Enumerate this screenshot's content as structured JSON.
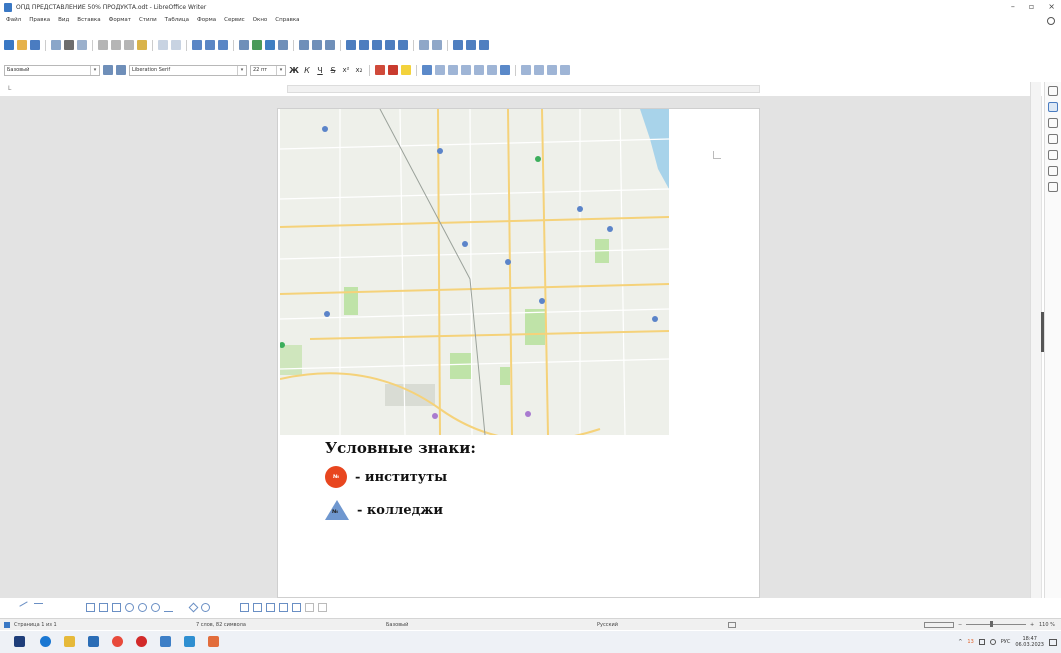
{
  "window": {
    "title": "ОПД ПРЕДСТАВЛЕНИЕ 50% ПРОДУКТА.odt - LibreOffice Writer",
    "controls": [
      "–",
      "▫",
      "×"
    ]
  },
  "menu": [
    "Файл",
    "Правка",
    "Вид",
    "Вставка",
    "Формат",
    "Стили",
    "Таблица",
    "Форма",
    "Сервис",
    "Окно",
    "Справка"
  ],
  "format_toolbar": {
    "paragraph_style": "Базовый",
    "font_name": "Liberation Serif",
    "font_size": "22 пт",
    "bold_label": "Ж",
    "italic_label": "К",
    "underline_label": "Ч",
    "strike_label": "S",
    "superscript_label": "x²",
    "subscript_label": "x₂"
  },
  "document": {
    "legend_title": "Условные знаки:",
    "legend_items": [
      {
        "symbol_text": "№",
        "label": "- институты"
      },
      {
        "symbol_text": "№",
        "label": "- колледжи"
      }
    ]
  },
  "statusbar": {
    "page": "Страница 1 из 1",
    "words": "7 слов, 82 символа",
    "page_style": "Базовый",
    "language": "Русский",
    "zoom": "110 %"
  },
  "taskbar": {
    "tray_keyboard": "РУС",
    "time": "18:47",
    "date": "06.03.2023",
    "notification_count": "13"
  },
  "colors": {
    "institute_marker": "#e8461f",
    "college_marker": "#6f97cf",
    "map_background": "#eef0ea",
    "main_road": "#f5d27a",
    "park": "#bfe3a8",
    "river": "#a8d3ea"
  }
}
